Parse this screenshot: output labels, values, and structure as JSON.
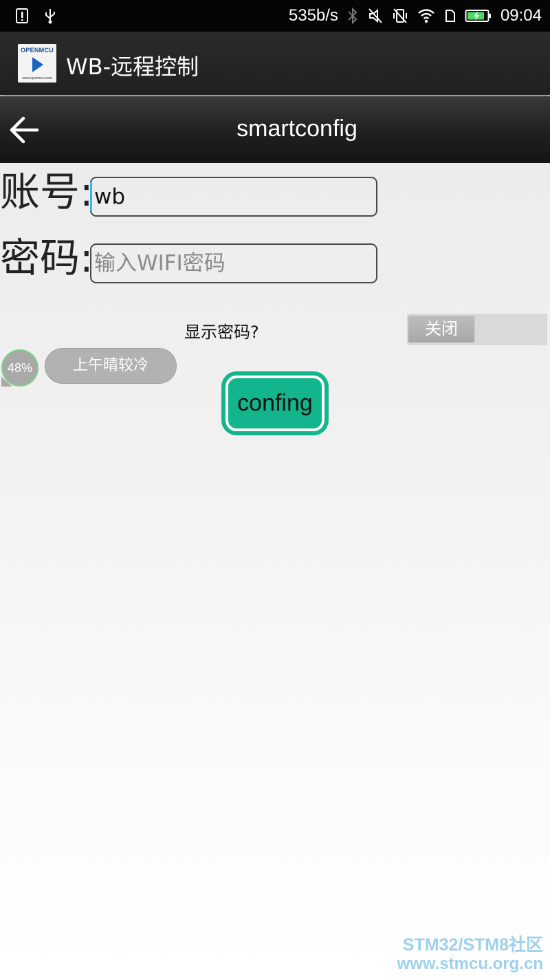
{
  "status_bar": {
    "speed": "535b/s",
    "time": "09:04",
    "icons": [
      "sim-alert-icon",
      "usb-icon",
      "bluetooth-icon",
      "mute-icon",
      "vibrate-off-icon",
      "wifi-icon",
      "sim-icon",
      "battery-icon"
    ]
  },
  "app_bar": {
    "title": "WB-远程控制",
    "logo_text": "OPENMCU",
    "logo_subtext": "www.openmcu.com"
  },
  "toolbar": {
    "title": "smartconfig",
    "back_icon": "arrow-left-icon"
  },
  "form": {
    "account_label": "账号:",
    "account_value": "wb",
    "password_label": "密码:",
    "password_placeholder": "输入WIFI密码",
    "show_password_label": "显示密码?",
    "toggle_state": "关闭"
  },
  "widget": {
    "battery_percent": "48%",
    "weather_text": "上午晴较冷"
  },
  "actions": {
    "confing_label": "confing"
  },
  "watermark": {
    "line1": "STM32/STM8社区",
    "line2": "www.stmcu.org.cn"
  },
  "colors": {
    "accent": "#13b58c",
    "cursor": "#33b5e5",
    "bar_dark": "#202020"
  }
}
